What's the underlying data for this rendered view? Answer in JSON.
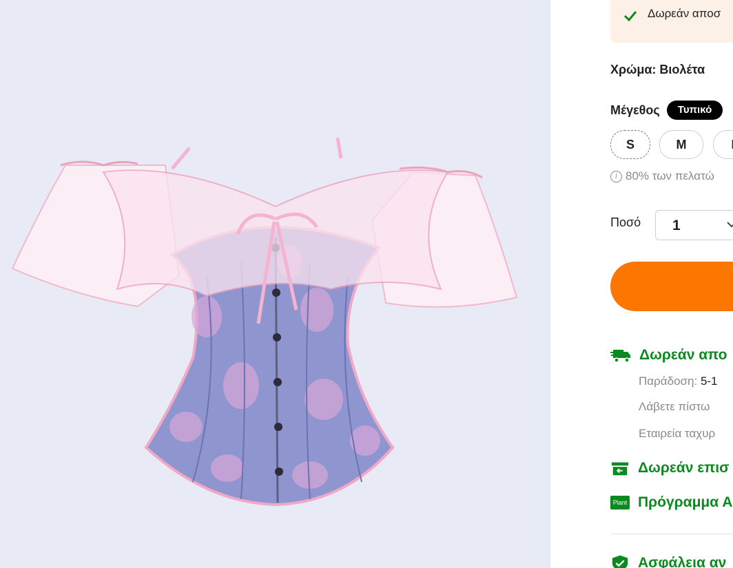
{
  "product_image": {
    "alt_icon": "corset-product-image"
  },
  "banner": {
    "text": "Δωρεάν αποσ"
  },
  "color": {
    "label": "Χρώμα: Βιολέτα"
  },
  "size": {
    "label": "Μέγεθος",
    "badge": "Τυπικό",
    "options": [
      "S",
      "M",
      "L"
    ],
    "fit_note": "80% των πελατώ"
  },
  "quantity": {
    "label": "Ποσό",
    "value": "1"
  },
  "shipping": {
    "free_shipping": "Δωρεάν απο",
    "delivery_label": "Παράδοση:",
    "delivery_value": "5-1",
    "credit_note": "Λάβετε πίστω",
    "courier_note": "Εταιρεία ταχυρ",
    "free_returns": "Δωρεάν επισ",
    "plant_program": "Πρόγραμμα Α",
    "plant_badge": "Plant",
    "security": "Ασφάλεια αν"
  },
  "colors": {
    "accent_orange": "#fb7701",
    "success_green": "#0a8a1f",
    "banner_bg": "#fdf1e7"
  }
}
